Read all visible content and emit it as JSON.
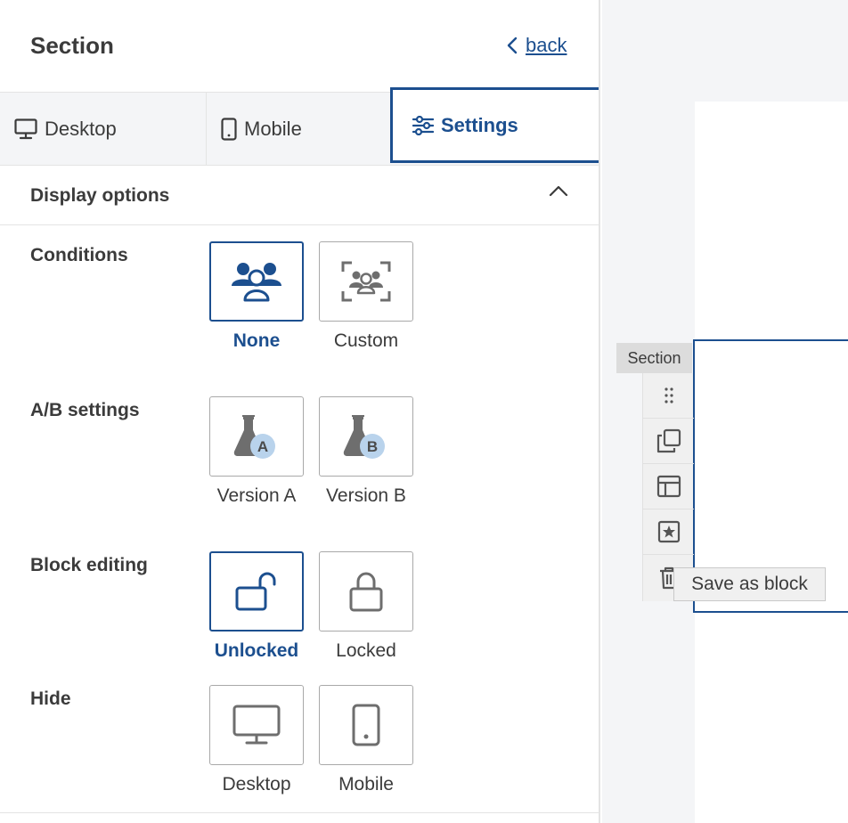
{
  "header": {
    "title": "Section",
    "back_label": "back"
  },
  "tabs": [
    {
      "label": "Desktop",
      "icon": "monitor-icon"
    },
    {
      "label": "Mobile",
      "icon": "phone-icon"
    },
    {
      "label": "Settings",
      "icon": "sliders-icon",
      "active": true
    }
  ],
  "display_options": {
    "title": "Display options",
    "expanded": true
  },
  "rows": {
    "conditions": {
      "label": "Conditions",
      "options": [
        {
          "label": "None",
          "icon": "users-icon",
          "selected": true
        },
        {
          "label": "Custom",
          "icon": "users-frame-icon",
          "selected": false
        }
      ]
    },
    "ab": {
      "label": "A/B settings",
      "options": [
        {
          "label": "Version A",
          "icon": "flask-a-icon",
          "badge": "A",
          "selected": false
        },
        {
          "label": "Version B",
          "icon": "flask-b-icon",
          "badge": "B",
          "selected": false
        }
      ]
    },
    "block_editing": {
      "label": "Block editing",
      "options": [
        {
          "label": "Unlocked",
          "icon": "unlock-icon",
          "selected": true
        },
        {
          "label": "Locked",
          "icon": "lock-icon",
          "selected": false
        }
      ]
    },
    "hide": {
      "label": "Hide",
      "options": [
        {
          "label": "Desktop",
          "icon": "monitor-icon",
          "selected": false
        },
        {
          "label": "Mobile",
          "icon": "phone-icon",
          "selected": false
        }
      ]
    }
  },
  "canvas": {
    "section_tag": "Section",
    "toolbar": [
      "drag-handle-icon",
      "duplicate-icon",
      "layout-icon",
      "star-icon",
      "trash-icon"
    ],
    "tooltip": "Save as block"
  },
  "colors": {
    "accent": "#1c4f8f",
    "badge": "#b9d3ec",
    "icon_gray": "#6e6e6e"
  }
}
